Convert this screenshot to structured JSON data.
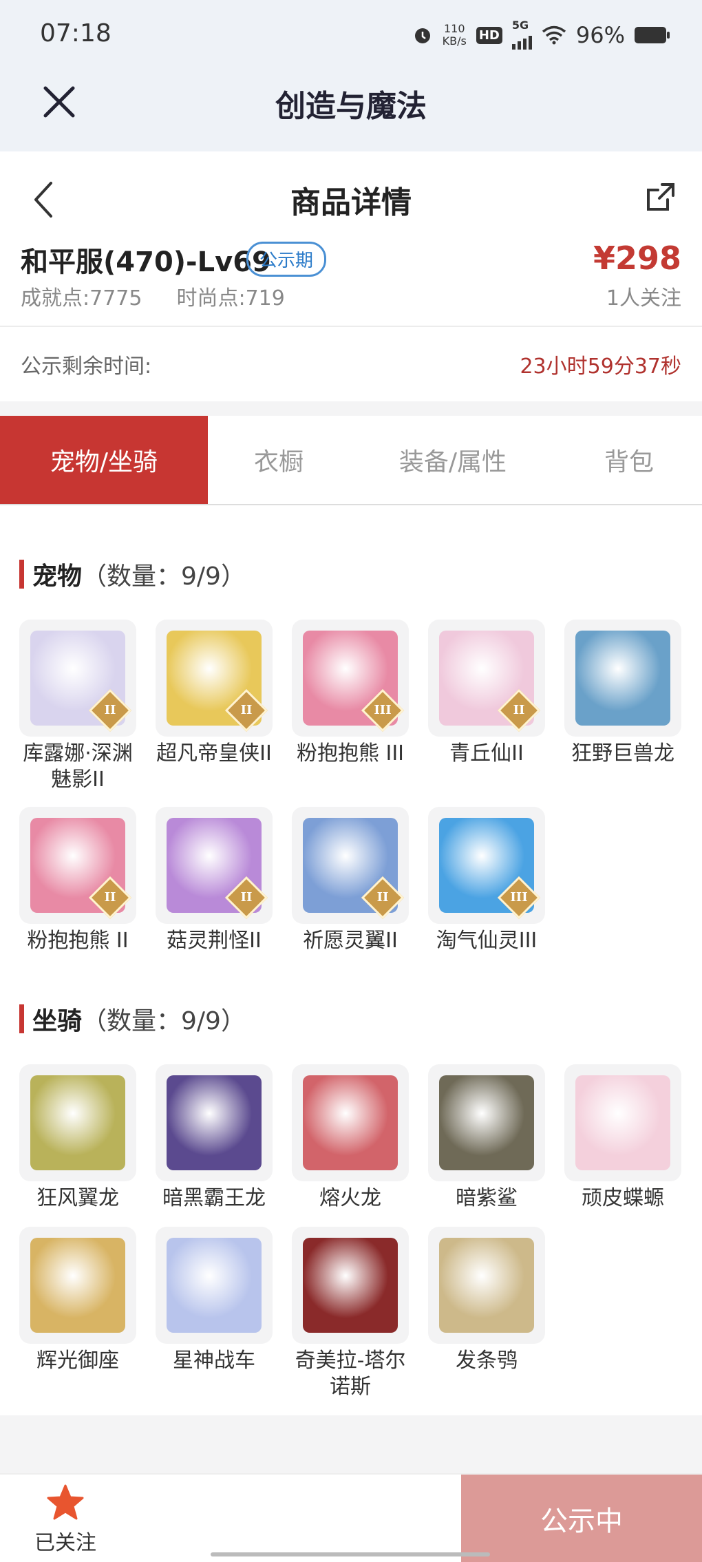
{
  "status_bar": {
    "time": "07:18",
    "net_speed_value": "110",
    "net_speed_unit": "KB/s",
    "hd_badge": "HD",
    "network": "5G",
    "battery": "96%"
  },
  "app_header": {
    "title": "创造与魔法",
    "close_icon": "close-icon"
  },
  "page": {
    "title": "商品详情",
    "back_icon": "chevron-left-icon",
    "share_icon": "share-icon"
  },
  "item": {
    "name": "和平服(470)-Lv69",
    "tag": "公示期",
    "price": "¥298",
    "achievement": "成就点:7775",
    "fashion": "时尚点:719",
    "followers": "1人关注"
  },
  "countdown": {
    "label": "公示剩余时间:",
    "value": "23小时59分37秒"
  },
  "tabs": [
    {
      "label": "宠物/坐骑",
      "active": true
    },
    {
      "label": "衣橱",
      "active": false
    },
    {
      "label": "装备/属性",
      "active": false
    },
    {
      "label": "背包",
      "active": false
    }
  ],
  "pets": {
    "title": "宠物",
    "count": "（数量：9/9）",
    "items": [
      {
        "name": "库露娜·深渊魅影II",
        "rank": "II",
        "color": "#d9d4ee"
      },
      {
        "name": "超凡帝皇侠II",
        "rank": "II",
        "color": "#e8c85a"
      },
      {
        "name": "粉抱抱熊 III",
        "rank": "III",
        "color": "#e88aa5"
      },
      {
        "name": "青丘仙II",
        "rank": "II",
        "color": "#f0c9dc"
      },
      {
        "name": "狂野巨兽龙",
        "rank": "",
        "color": "#6aa1c9"
      },
      {
        "name": "粉抱抱熊 II",
        "rank": "II",
        "color": "#e88aa5"
      },
      {
        "name": "菇灵荆怪II",
        "rank": "II",
        "color": "#b98ad8"
      },
      {
        "name": "祈愿灵翼II",
        "rank": "II",
        "color": "#7d9fd6"
      },
      {
        "name": "淘气仙灵III",
        "rank": "III",
        "color": "#4ba3e3"
      }
    ]
  },
  "mounts": {
    "title": "坐骑",
    "count": "（数量：9/9）",
    "items": [
      {
        "name": "狂风翼龙",
        "color": "#b9b25a"
      },
      {
        "name": "暗黑霸王龙",
        "color": "#5b4a8f"
      },
      {
        "name": "熔火龙",
        "color": "#d2646a"
      },
      {
        "name": "暗紫鲨",
        "color": "#6f6a57"
      },
      {
        "name": "顽皮蝶螈",
        "color": "#f4d0dc"
      },
      {
        "name": "辉光御座",
        "color": "#d8b464"
      },
      {
        "name": "星神战车",
        "color": "#b8c4ec"
      },
      {
        "name": "奇美拉-塔尔诺斯",
        "color": "#8a2a2a"
      },
      {
        "name": "发条鸮",
        "color": "#cdb98a"
      }
    ]
  },
  "bottom_bar": {
    "follow_label": "已关注",
    "status_button": "公示中"
  },
  "colors": {
    "accent": "#c73632",
    "price": "#c33a33",
    "tag": "#2b7bc9"
  }
}
